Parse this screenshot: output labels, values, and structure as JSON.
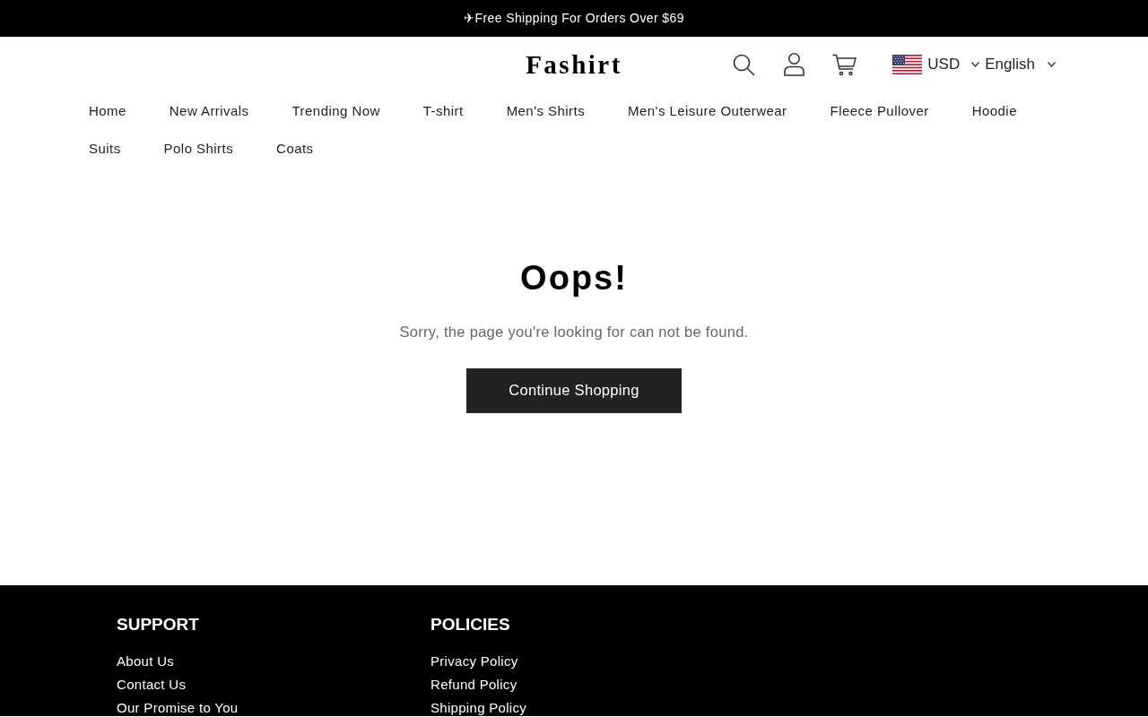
{
  "announcement": {
    "text": "✈Free Shipping For Orders Over $69"
  },
  "header": {
    "logo": "Fashirt",
    "currency": "USD",
    "language": "English"
  },
  "nav": {
    "items": [
      "Home",
      "New Arrivals",
      "Trending Now",
      "T-shirt",
      "Men's Shirts",
      "Men's Leisure Outerwear",
      "Fleece Pullover",
      "Hoodie",
      "Suits",
      "Polo Shirts",
      "Coats"
    ]
  },
  "error": {
    "title": "Oops!",
    "message": "Sorry, the page you're looking for can not be found.",
    "button": "Continue Shopping"
  },
  "footer": {
    "columns": [
      {
        "heading": "SUPPORT",
        "links": [
          "About Us",
          "Contact Us",
          "Our Promise to You"
        ]
      },
      {
        "heading": "POLICIES",
        "links": [
          "Privacy Policy",
          "Refund Policy",
          "Shipping Policy"
        ]
      }
    ]
  }
}
